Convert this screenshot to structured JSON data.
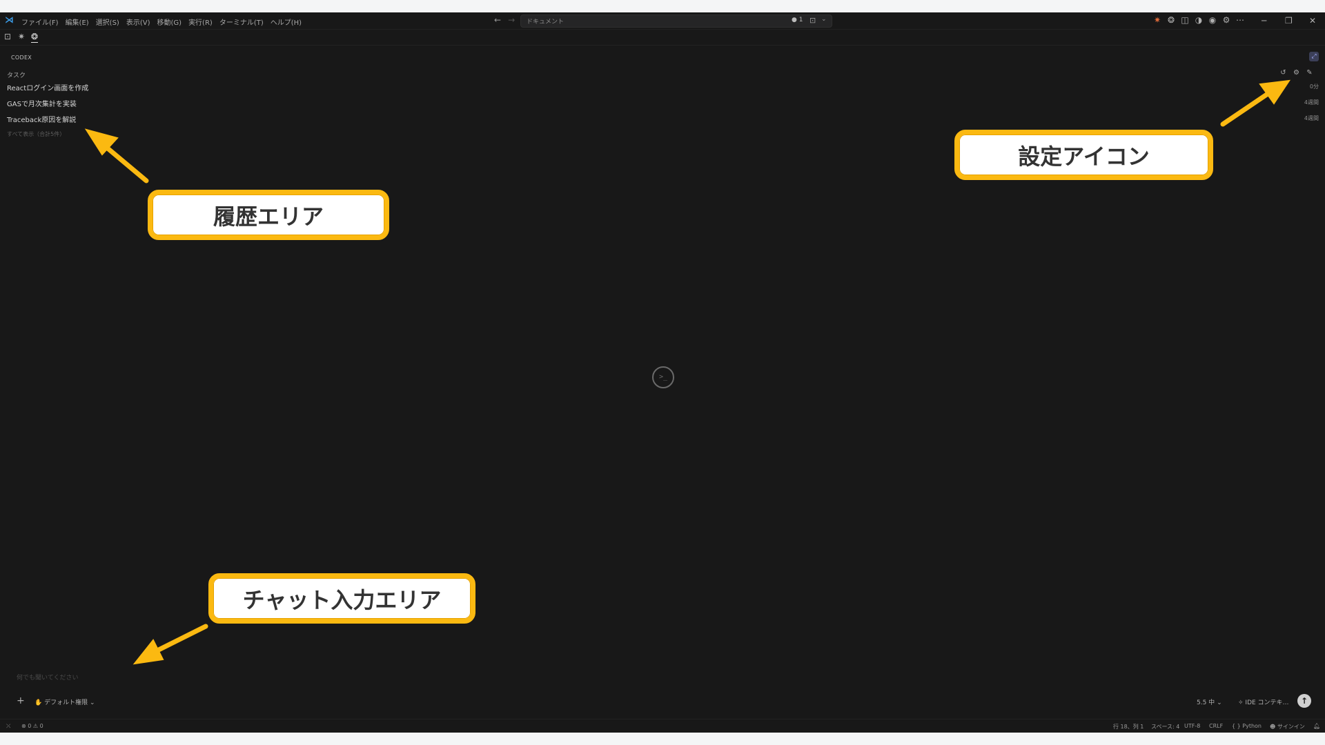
{
  "titlebar": {
    "menus": [
      "ファイル(F)",
      "編集(E)",
      "選択(S)",
      "表示(V)",
      "移動(G)",
      "実行(R)",
      "ターミナル(T)",
      "ヘルプ(H)"
    ],
    "command_center": "ドキュメント",
    "notification_count": "● 1"
  },
  "panel": {
    "title": "CODEX",
    "section_title": "タスク",
    "tasks": [
      {
        "title": "Reactログイン画面を作成",
        "time": "0分"
      },
      {
        "title": "GASで月次集計を実装",
        "time": "4週間"
      },
      {
        "title": "Traceback原因を解説",
        "time": "4週間"
      }
    ],
    "show_all": "すべて表示（合計5件）"
  },
  "chat": {
    "placeholder": "何でも聞いてください",
    "permission": "デフォルト権限",
    "model": "5.5 中",
    "context": "IDE コンテキ…"
  },
  "statusbar": {
    "problems": "0",
    "warnings": "0",
    "position": "行 18、列 1",
    "spaces": "スペース: 4",
    "encoding": "UTF-8",
    "eol": "CRLF",
    "language": "{ } Python",
    "signin": "サインイン"
  },
  "annotations": {
    "history": "履歴エリア",
    "settings": "設定アイコン",
    "chat_input": "チャット入力エリア"
  },
  "colors": {
    "accent_callout": "#fbb911",
    "window_bg": "#181818",
    "vscode_blue": "#3c9eea"
  }
}
